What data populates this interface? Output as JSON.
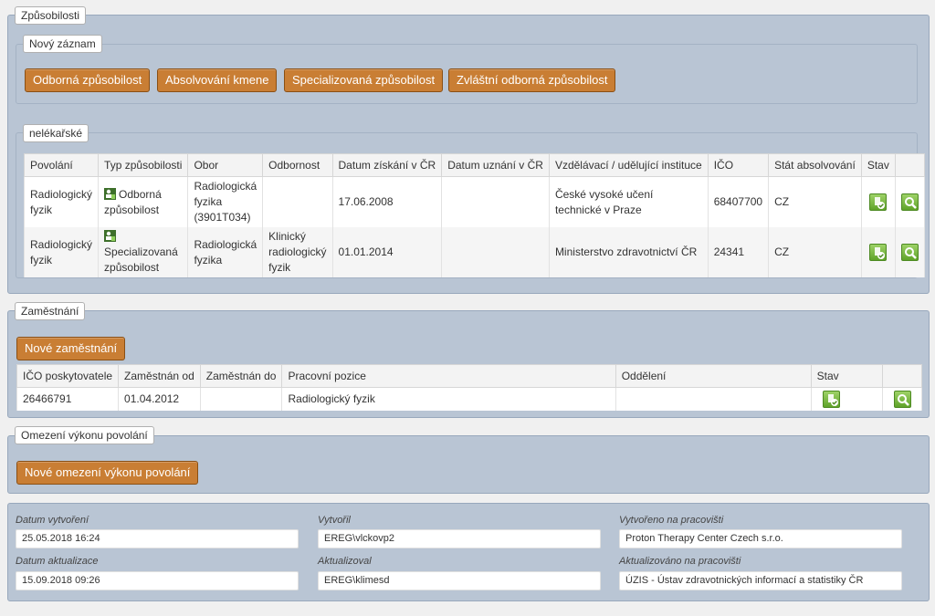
{
  "zpusobilosti": {
    "title": "Způsobilosti",
    "novy_zaznam": {
      "title": "Nový záznam",
      "buttons": [
        "Odborná způsobilost",
        "Absolvování kmene",
        "Specializovaná způsobilost",
        "Zvláštní odborná způsobilost"
      ]
    },
    "nelekarske": {
      "title": "nelékařské",
      "headers": [
        "Povolání",
        "Typ způsobilosti",
        "Obor",
        "Odbornost",
        "Datum získání v ČR",
        "Datum uznání v ČR",
        "Vzdělávací / udělující instituce",
        "IČO",
        "Stát absolvování",
        "Stav",
        ""
      ],
      "rows": [
        {
          "povolani": "Radiologický fyzik",
          "typ": "Odborná způsobilost",
          "typ_icon": "person-badge-icon",
          "obor": "Radiologická fyzika (3901T034)",
          "odbornost": "",
          "datum_ziskani": "17.06.2008",
          "datum_uznani": "",
          "instituce": "České vysoké učení technické v Praze",
          "ico": "68407700",
          "stat": "CZ"
        },
        {
          "povolani": "Radiologický fyzik",
          "typ": "Specializovaná způsobilost",
          "typ_icon": "person-badge-icon",
          "obor": "Radiologická fyzika",
          "odbornost": "Klinický radiologický fyzik",
          "datum_ziskani": "01.01.2014",
          "datum_uznani": "",
          "instituce": "Ministerstvo zdravotnictví ČR",
          "ico": "24341",
          "stat": "CZ"
        }
      ]
    }
  },
  "zamestnani": {
    "title": "Zaměstnání",
    "new_button": "Nové zaměstnání",
    "headers": [
      "IČO poskytovatele",
      "Zaměstnán od",
      "Zaměstnán do",
      "Pracovní pozice",
      "Oddělení",
      "Stav",
      ""
    ],
    "rows": [
      {
        "ico": "26466791",
        "od": "01.04.2012",
        "do": "",
        "pozice": "Radiologický fyzik",
        "oddeleni": ""
      }
    ]
  },
  "omezeni": {
    "title": "Omezení výkonu povolání",
    "new_button": "Nové omezení výkonu povolání"
  },
  "meta": {
    "datum_vytvoreni_label": "Datum vytvoření",
    "datum_vytvoreni": "25.05.2018 16:24",
    "vytvoril_label": "Vytvořil",
    "vytvoril": "EREG\\vlckovp2",
    "vytvoreno_pracoviste_label": "Vytvořeno na pracovišti",
    "vytvoreno_pracoviste": "Proton Therapy Center Czech s.r.o.",
    "datum_aktualizace_label": "Datum aktualizace",
    "datum_aktualizace": "15.09.2018 09:26",
    "aktualizoval_label": "Aktualizoval",
    "aktualizoval": "EREG\\klimesd",
    "aktualizovano_pracoviste_label": "Aktualizováno na pracovišti",
    "aktualizovano_pracoviste": "ÚZIS - Ústav zdravotnických informací a statistiky ČR"
  },
  "icons": {
    "status": "status-approve-icon",
    "detail": "magnify-icon",
    "green": "#6cb33a",
    "orange": "#c97e34"
  }
}
